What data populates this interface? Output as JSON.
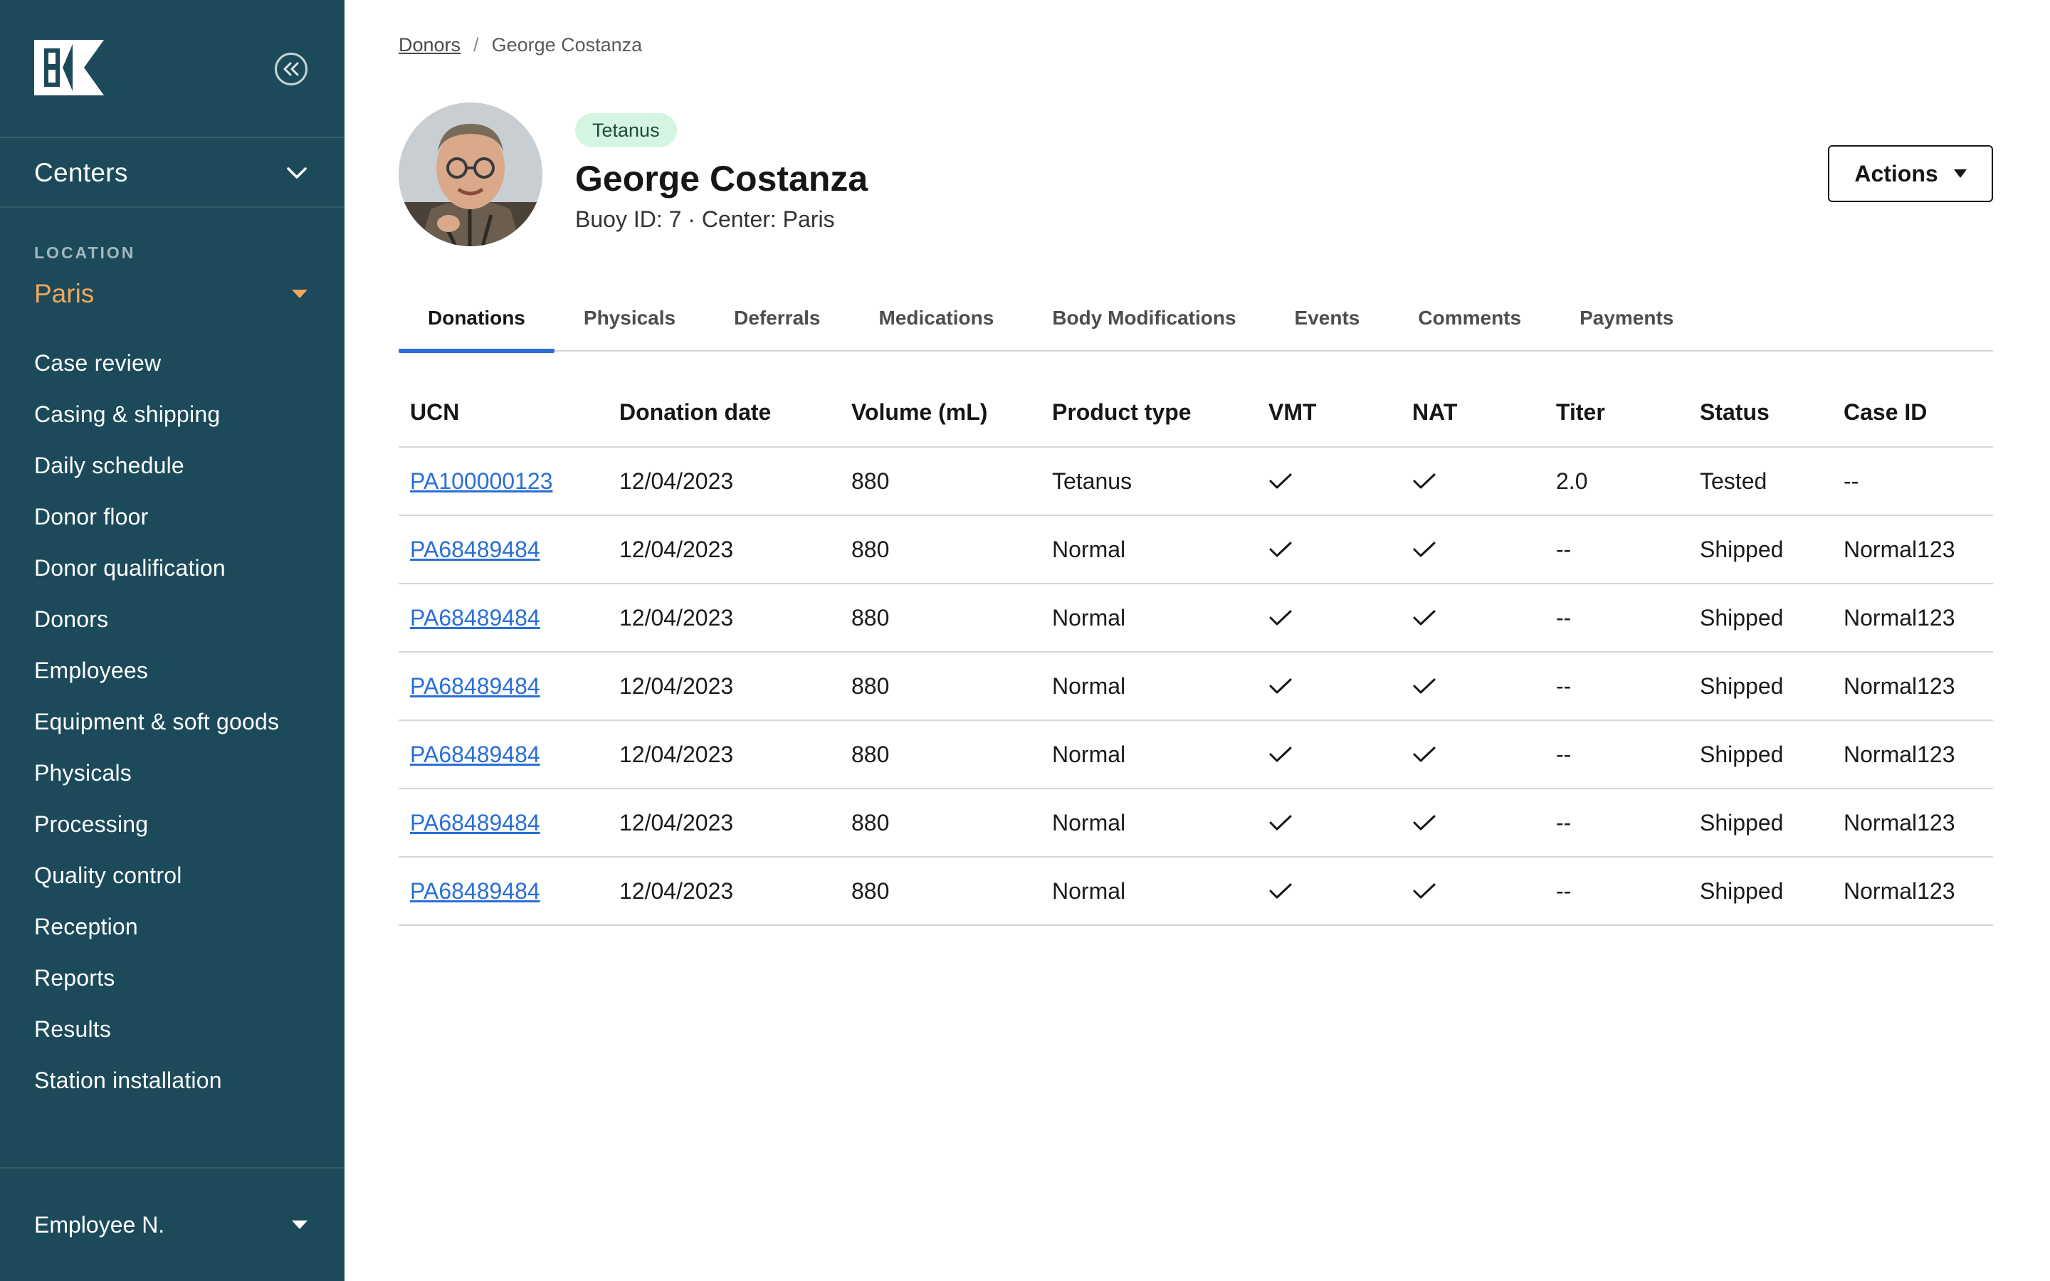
{
  "colors": {
    "sidebar_bg": "#1c4a5a",
    "accent_orange": "#f2a65a",
    "link_blue": "#2a6fd6",
    "tag_bg": "#d5f5e3"
  },
  "sidebar": {
    "logo_text": "BK",
    "collapse_icon": "double-chevron-left-icon",
    "centers_label": "Centers",
    "location_caption": "LOCATION",
    "location_value": "Paris",
    "nav_items": [
      {
        "label": "Case review"
      },
      {
        "label": "Casing & shipping"
      },
      {
        "label": "Daily schedule"
      },
      {
        "label": "Donor floor"
      },
      {
        "label": "Donor qualification"
      },
      {
        "label": "Donors"
      },
      {
        "label": "Employees"
      },
      {
        "label": "Equipment & soft goods"
      },
      {
        "label": "Physicals"
      },
      {
        "label": "Processing"
      },
      {
        "label": "Quality control"
      },
      {
        "label": "Reception"
      },
      {
        "label": "Reports"
      },
      {
        "label": "Results"
      },
      {
        "label": "Station installation"
      }
    ],
    "employee_label": "Employee N."
  },
  "breadcrumb": {
    "parent": "Donors",
    "separator": "/",
    "current": "George Costanza"
  },
  "donor": {
    "tag": "Tetanus",
    "name": "George Costanza",
    "meta": "Buoy ID: 7 · Center: Paris"
  },
  "actions_label": "Actions",
  "tabs": [
    {
      "label": "Donations",
      "active": true
    },
    {
      "label": "Physicals"
    },
    {
      "label": "Deferrals"
    },
    {
      "label": "Medications"
    },
    {
      "label": "Body Modifications"
    },
    {
      "label": "Events"
    },
    {
      "label": "Comments"
    },
    {
      "label": "Payments"
    }
  ],
  "table": {
    "headers": [
      "UCN",
      "Donation date",
      "Volume (mL)",
      "Product type",
      "VMT",
      "NAT",
      "Titer",
      "Status",
      "Case ID"
    ],
    "rows": [
      {
        "ucn": "PA100000123",
        "date": "12/04/2023",
        "volume": "880",
        "product": "Tetanus",
        "vmt": true,
        "nat": true,
        "titer": "2.0",
        "status": "Tested",
        "case_id": "--"
      },
      {
        "ucn": "PA68489484",
        "date": "12/04/2023",
        "volume": "880",
        "product": "Normal",
        "vmt": true,
        "nat": true,
        "titer": "--",
        "status": "Shipped",
        "case_id": "Normal123"
      },
      {
        "ucn": "PA68489484",
        "date": "12/04/2023",
        "volume": "880",
        "product": "Normal",
        "vmt": true,
        "nat": true,
        "titer": "--",
        "status": "Shipped",
        "case_id": "Normal123"
      },
      {
        "ucn": "PA68489484",
        "date": "12/04/2023",
        "volume": "880",
        "product": "Normal",
        "vmt": true,
        "nat": true,
        "titer": "--",
        "status": "Shipped",
        "case_id": "Normal123"
      },
      {
        "ucn": "PA68489484",
        "date": "12/04/2023",
        "volume": "880",
        "product": "Normal",
        "vmt": true,
        "nat": true,
        "titer": "--",
        "status": "Shipped",
        "case_id": "Normal123"
      },
      {
        "ucn": "PA68489484",
        "date": "12/04/2023",
        "volume": "880",
        "product": "Normal",
        "vmt": true,
        "nat": true,
        "titer": "--",
        "status": "Shipped",
        "case_id": "Normal123"
      },
      {
        "ucn": "PA68489484",
        "date": "12/04/2023",
        "volume": "880",
        "product": "Normal",
        "vmt": true,
        "nat": true,
        "titer": "--",
        "status": "Shipped",
        "case_id": "Normal123"
      }
    ]
  }
}
